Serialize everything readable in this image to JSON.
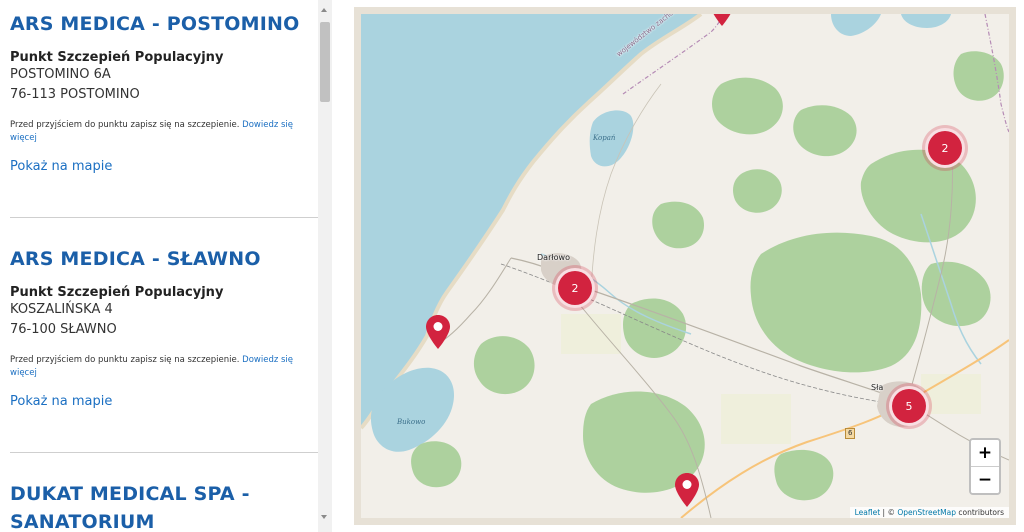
{
  "entries": [
    {
      "title_lines": [
        "ARS MEDICA - POSTOMINO"
      ],
      "type": "Punkt Szczepień Populacyjny",
      "street": "POSTOMINO 6A",
      "city": "76-113 POSTOMINO",
      "note": "Przed przyjściem do punktu zapisz się na szczepienie.",
      "note_link": "Dowiedz się więcej",
      "map_link": "Pokaż na mapie"
    },
    {
      "title_lines": [
        "ARS MEDICA - SŁAWNO"
      ],
      "type": "Punkt Szczepień Populacyjny",
      "street": "KOSZALIŃSKA 4",
      "city": "76-100 SŁAWNO",
      "note": "Przed przyjściem do punktu zapisz się na szczepienie.",
      "note_link": "Dowiedz się więcej",
      "map_link": "Pokaż na mapie"
    },
    {
      "title_lines": [
        "DUKAT MEDICAL SPA -",
        "SANATORIUM"
      ]
    }
  ],
  "map": {
    "clusters": [
      {
        "count": "2",
        "name": "cluster-north-east"
      },
      {
        "count": "2",
        "name": "cluster-darlowo"
      },
      {
        "count": "5",
        "name": "cluster-slawno"
      }
    ],
    "labels": {
      "darlowo": "Darłowo",
      "slawno": "Sła",
      "kopan": "Kopań",
      "bukowo": "Bukowo",
      "voivodeship": "województwo zachodnio",
      "road_6": "6"
    },
    "zoom_in": "+",
    "zoom_out": "−",
    "attribution": {
      "leaflet": "Leaflet",
      "separator": " | © ",
      "osm": "OpenStreetMap",
      "suffix": " contributors"
    },
    "colors": {
      "sea": "#aad3df",
      "forest": "#add19e",
      "land": "#f2efe9",
      "marker": "#d2233f"
    }
  }
}
